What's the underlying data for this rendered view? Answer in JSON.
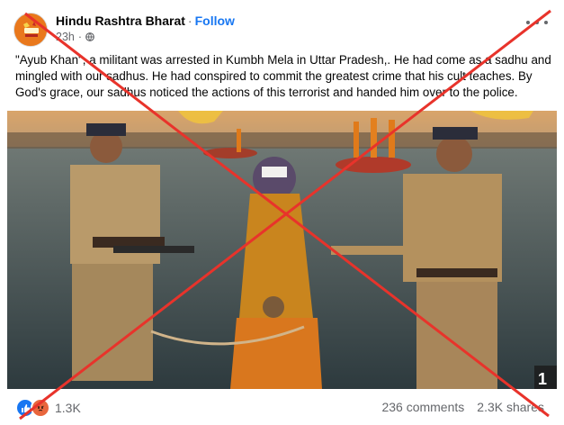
{
  "post": {
    "page_name": "Hindu Rashtra Bharat",
    "separator": "·",
    "follow_label": "Follow",
    "time": "23h",
    "caption": "\"Ayub Khan\", a militant was arrested in Kumbh Mela in Uttar Pradesh,. He had come as a sadhu and mingled with our sadhus. He had conspired to commit the greatest crime that his cult teaches. By God's grace, our sadhus noticed the actions of this terrorist and handed him over to the police.",
    "image_corner_text": "1"
  },
  "footer": {
    "reaction_count": "1.3K",
    "comments": "236 comments",
    "shares": "2.3K shares",
    "reactions": [
      "like-icon",
      "angry-icon"
    ]
  },
  "colors": {
    "accent": "#1877f2",
    "cross": "#e8332b",
    "avatar": "#e8751a",
    "muted": "#65676b"
  }
}
